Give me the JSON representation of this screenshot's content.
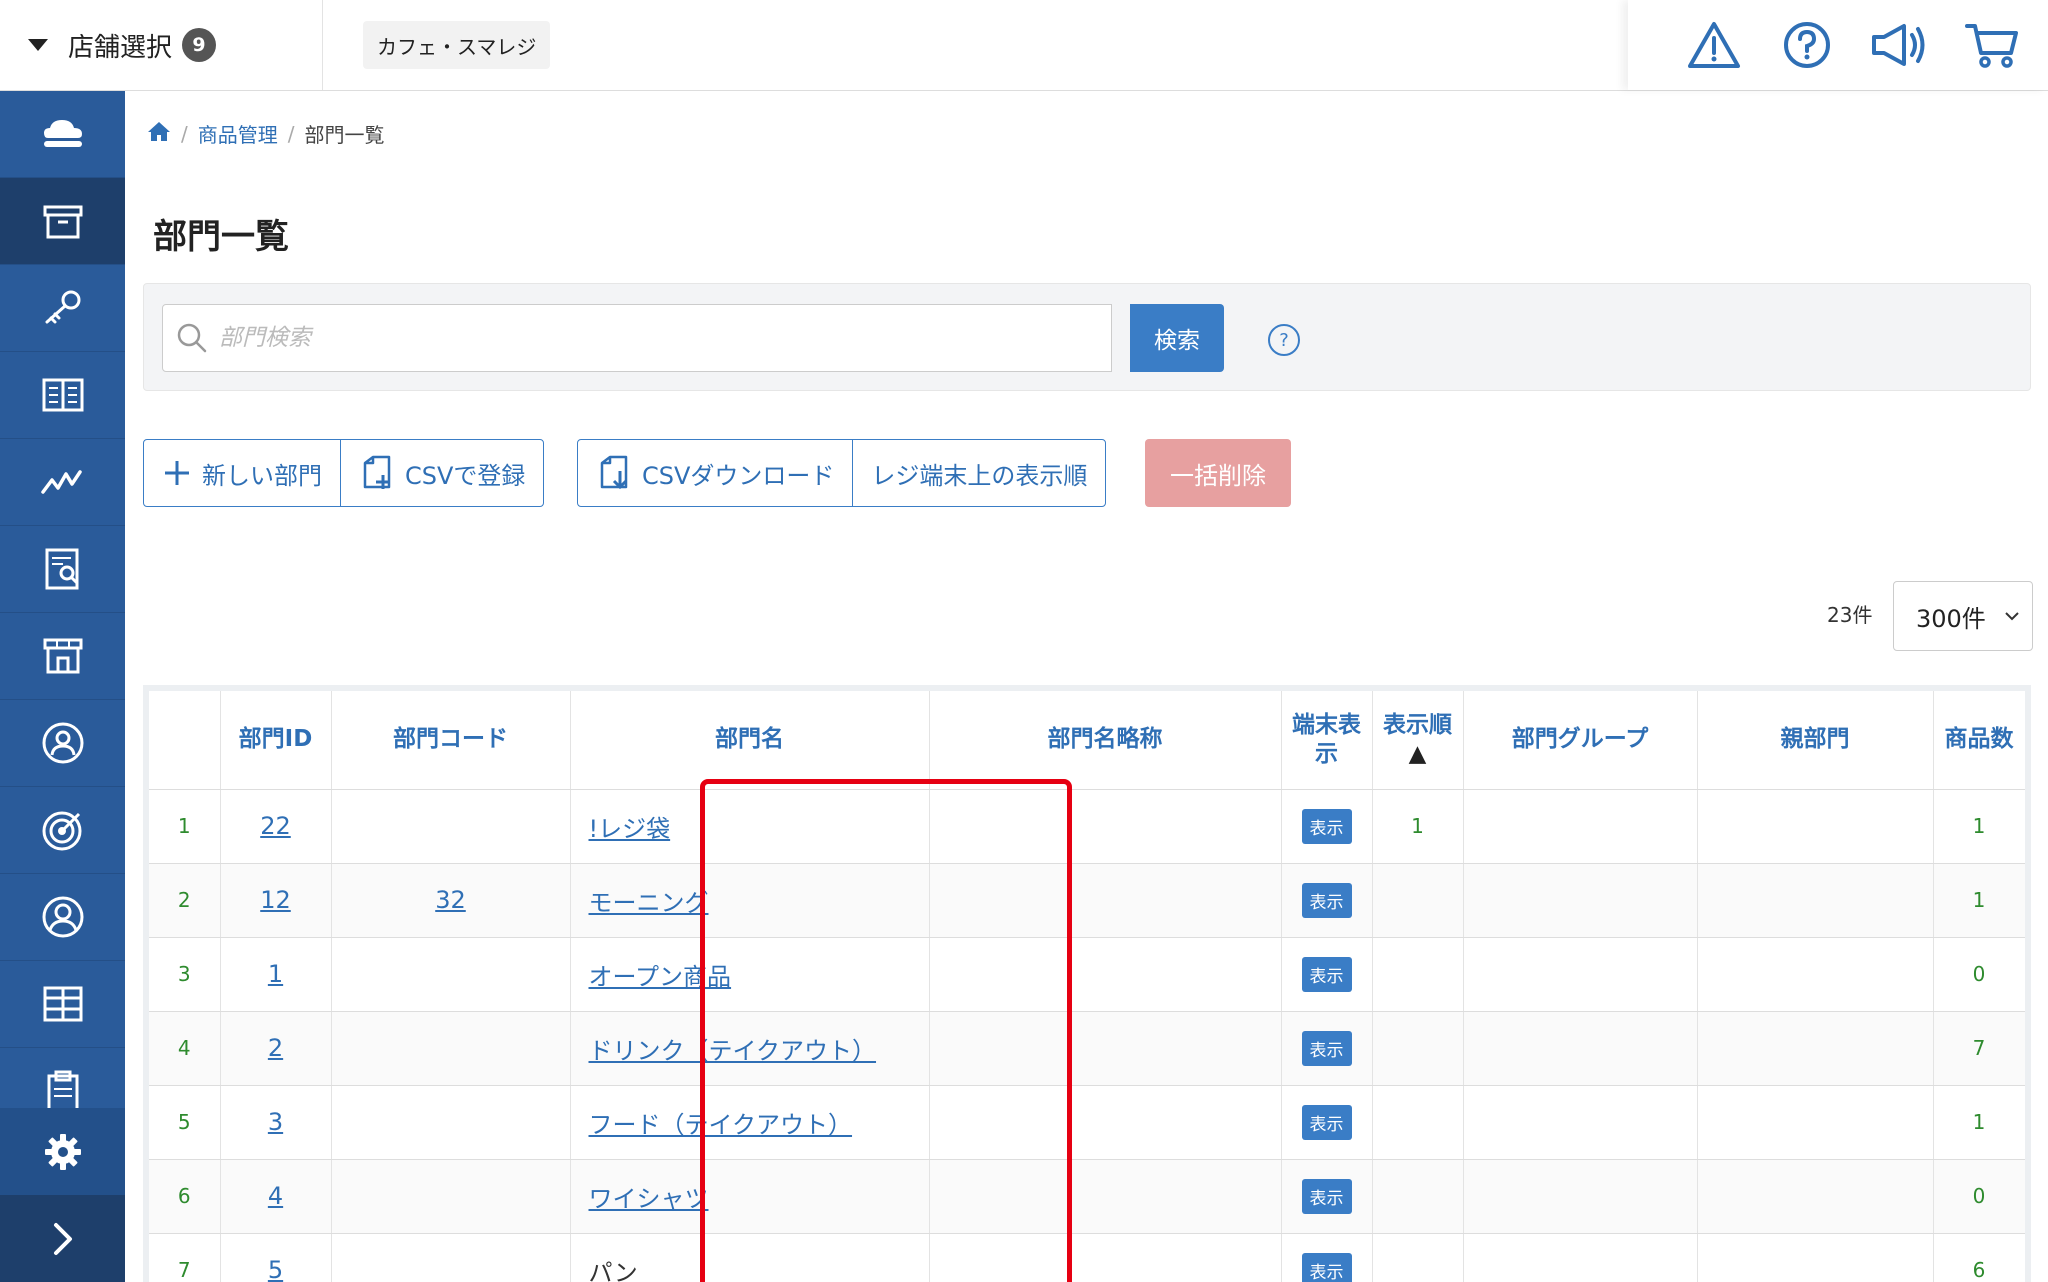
{
  "topbar": {
    "store_select_label": "店舗選択",
    "store_count": "9",
    "store_name": "カフェ・スマレジ"
  },
  "breadcrumb": {
    "level1": "商品管理",
    "level2": "部門一覧"
  },
  "page": {
    "title": "部門一覧"
  },
  "search": {
    "placeholder": "部門検索",
    "button_label": "検索",
    "help": "?"
  },
  "actions": {
    "new_dept": "新しい部門",
    "csv_register": "CSVで登録",
    "csv_download": "CSVダウンロード",
    "register_display_order": "レジ端末上の表示順",
    "bulk_delete": "一括削除"
  },
  "pagination": {
    "count": "23件",
    "per_page": "300件"
  },
  "table": {
    "headers": {
      "dept_id": "部門ID",
      "dept_code": "部門コード",
      "dept_name": "部門名",
      "dept_short": "部門名略称",
      "terminal_display": "端末表示",
      "display_order": "表示順",
      "sort_arrow": "▲",
      "dept_group": "部門グループ",
      "parent_dept": "親部門",
      "product_count": "商品数"
    },
    "rows": [
      {
        "no": "1",
        "id": "22",
        "code": "",
        "name": "!レジ袋",
        "short": "",
        "terminal": "表示",
        "order": "1",
        "group": "",
        "parent": "",
        "count": "1"
      },
      {
        "no": "2",
        "id": "12",
        "code": "32",
        "name": "モーニング",
        "short": "",
        "terminal": "表示",
        "order": "",
        "group": "",
        "parent": "",
        "count": "1"
      },
      {
        "no": "3",
        "id": "1",
        "code": "",
        "name": "オープン商品",
        "short": "",
        "terminal": "表示",
        "order": "",
        "group": "",
        "parent": "",
        "count": "0"
      },
      {
        "no": "4",
        "id": "2",
        "code": "",
        "name": "ドリンク（テイクアウト）",
        "short": "",
        "terminal": "表示",
        "order": "",
        "group": "",
        "parent": "",
        "count": "7"
      },
      {
        "no": "5",
        "id": "3",
        "code": "",
        "name": "フード（テイクアウト）",
        "short": "",
        "terminal": "表示",
        "order": "",
        "group": "",
        "parent": "",
        "count": "1"
      },
      {
        "no": "6",
        "id": "4",
        "code": "",
        "name": "ワイシャツ",
        "short": "",
        "terminal": "表示",
        "order": "",
        "group": "",
        "parent": "",
        "count": "0"
      },
      {
        "no": "7",
        "id": "5",
        "code": "",
        "name": "パン",
        "short": "",
        "terminal": "表示",
        "order": "",
        "group": "",
        "parent": "",
        "count": "6"
      }
    ]
  },
  "colors": {
    "sidebar": "#2a5b9a",
    "accent": "#3a7dc6",
    "highlight": "#e60012",
    "danger_disabled": "#e7a0a0"
  },
  "icons": {
    "topbar": [
      "warning-icon",
      "help-icon",
      "megaphone-icon",
      "cart-icon"
    ],
    "sidebar": [
      "cloud-logo-icon",
      "archive-box-icon",
      "key-icon",
      "ledger-icon",
      "analytics-icon",
      "report-icon",
      "store-icon",
      "staff-icon",
      "target-icon",
      "customer-icon",
      "grid-icon",
      "clipboard-icon",
      "gear-icon",
      "chevron-right-icon"
    ]
  }
}
